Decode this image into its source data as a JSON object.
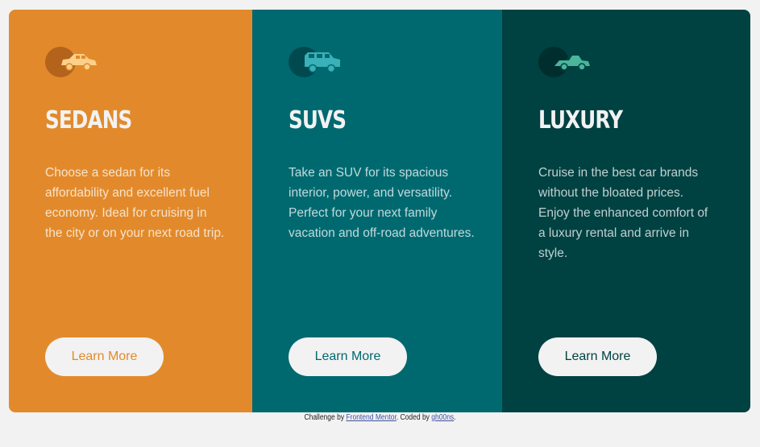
{
  "colors": {
    "sedans": "#e28a2b",
    "suvs": "#006970",
    "luxury": "#004142",
    "background": "#f2f2f2"
  },
  "cards": [
    {
      "icon": "sedan-car-icon",
      "title": "SEDANS",
      "text": "Choose a sedan for its affordability and excellent fuel economy. Ideal for cruising in the city or on your next road trip.",
      "button": "Learn More"
    },
    {
      "icon": "suv-car-icon",
      "title": "SUVS",
      "text": "Take an SUV for its spacious interior, power, and versatility. Perfect for your next family vacation and off-road adventures.",
      "button": "Learn More"
    },
    {
      "icon": "luxury-car-icon",
      "title": "LUXURY",
      "text": "Cruise in the best car brands without the bloated prices. Enjoy the enhanced comfort of a luxury rental and arrive in style.",
      "button": "Learn More"
    }
  ],
  "attribution": {
    "prefix": "Challenge by ",
    "link1": "Frontend Mentor",
    "middle": ". Coded by ",
    "link2": "gh00ns",
    "suffix": "."
  }
}
